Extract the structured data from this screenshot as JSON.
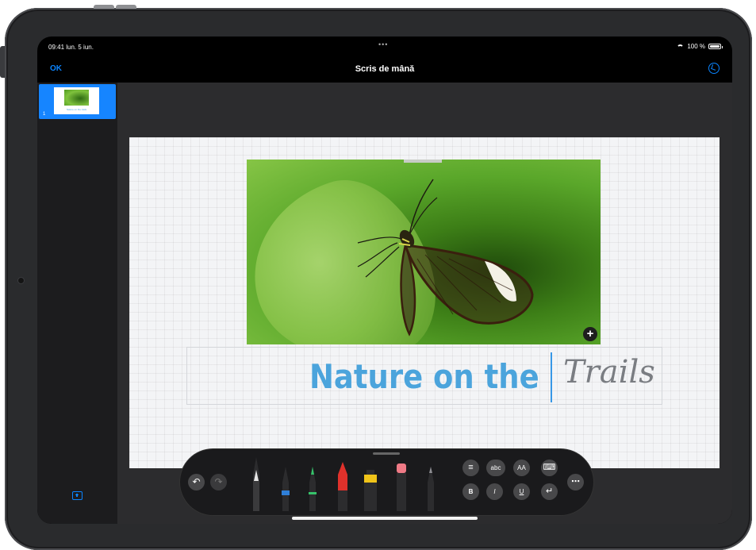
{
  "status_bar": {
    "time": "09:41 lun. 5 iun.",
    "dots": "•••",
    "battery": "100 %"
  },
  "navbar": {
    "done_label": "OK",
    "title": "Scris de mână"
  },
  "sidebar": {
    "slides": [
      {
        "number": "1",
        "thumb_text": "Nature on the trails"
      }
    ]
  },
  "slide": {
    "typed_text": "Nature on the",
    "handwritten_text": "Trails"
  },
  "toolbar": {
    "format_buttons": {
      "align": "≡",
      "spellcheck": "abc",
      "text_size": "AA",
      "keyboard": "⌨",
      "bold": "B",
      "italic": "I",
      "underline": "U",
      "return": "↵",
      "more": "⋯"
    },
    "tools": [
      "monoline-pen",
      "pen-blue",
      "marker-green",
      "crayon-red",
      "highlighter-yellow",
      "eraser",
      "pencil"
    ]
  },
  "colors": {
    "accent_blue": "#0a84ff",
    "typed_text_blue": "#4ba4dc",
    "pen_blue": "#2f7fd8",
    "marker_green": "#36c26a",
    "crayon_red": "#e0312b",
    "highlighter_yellow": "#f0c419",
    "eraser_pink": "#ef7a86"
  }
}
